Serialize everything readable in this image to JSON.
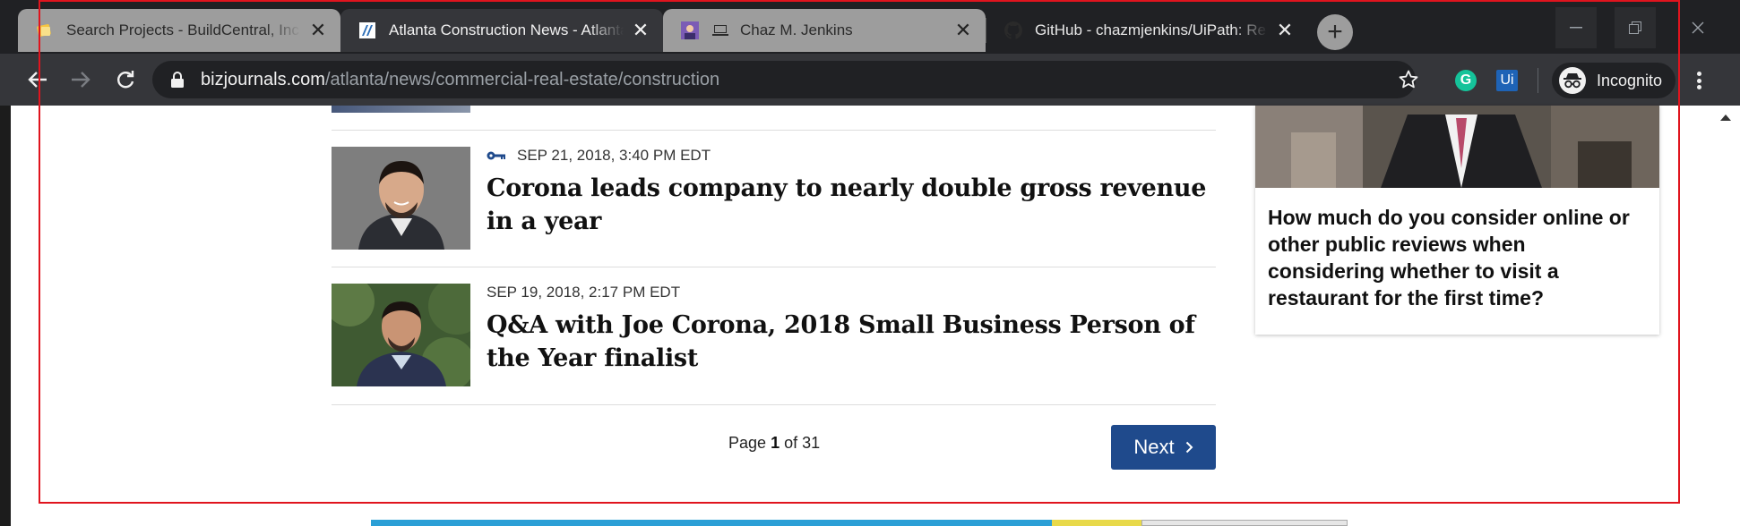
{
  "browser": {
    "tabs": [
      {
        "title": "Search Projects - BuildCentral, Inc",
        "favicon": "buildcentral-favicon",
        "active": false
      },
      {
        "title": "Atlanta Construction News - Atlanta",
        "favicon": "bizjournals-favicon",
        "active": true
      },
      {
        "title": "Chaz M. Jenkins",
        "favicon": "avatar-favicon",
        "active": false
      },
      {
        "title": "GitHub - chazmjenkins/UiPath: Re",
        "favicon": "github-favicon",
        "active": false
      }
    ],
    "tab_close_glyph": "✕",
    "new_tab_glyph": "+",
    "address": {
      "host": "bizjournals.com",
      "path": "/atlanta/news/commercial-real-estate/construction"
    },
    "extensions": {
      "grammarly": "G",
      "uipath": "Ui"
    },
    "incognito_label": "Incognito"
  },
  "articles": [
    {
      "timestamp": "SEP 21, 2018, 3:40 PM EDT",
      "premium": true,
      "headline": "Corona leads company to nearly double gross revenue in a year"
    },
    {
      "timestamp": "SEP 19, 2018, 2:17 PM EDT",
      "premium": false,
      "headline": "Q&A with Joe Corona, 2018 Small Business Person of the Year finalist"
    }
  ],
  "pagination": {
    "prefix": "Page",
    "current": "1",
    "of_label": "of",
    "total": "31",
    "next_label": "Next"
  },
  "sidebar": {
    "question": "How much do you consider online or other public reviews when considering whether to visit a restaurant for the first time?"
  },
  "colors": {
    "chrome_dark": "#202124",
    "chrome_toolbar": "#35363a",
    "next_button": "#1f4a8c",
    "annotation_red": "#e0141e",
    "premium_key": "#1f4a8c"
  }
}
